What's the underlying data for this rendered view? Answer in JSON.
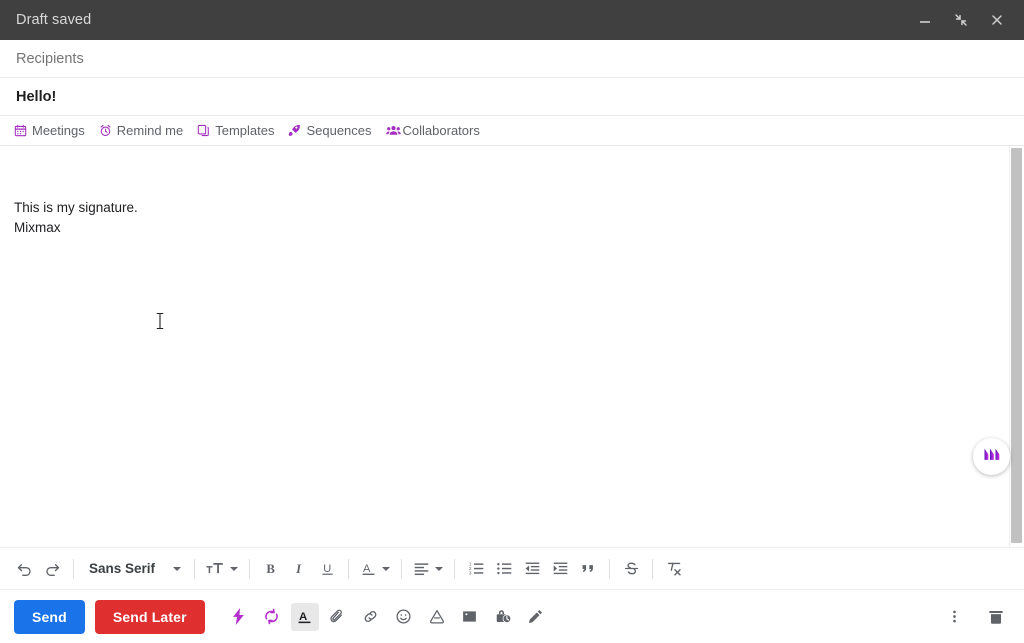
{
  "window": {
    "title": "Draft saved",
    "controls": [
      {
        "name": "minimize-button",
        "icon": "minimize-icon",
        "label": "Minimize"
      },
      {
        "name": "exit-fullscreen-button",
        "icon": "exit-fullscreen-icon",
        "label": "Exit full screen"
      },
      {
        "name": "close-button",
        "icon": "close-icon",
        "label": "Close"
      }
    ]
  },
  "fields": {
    "recipients_placeholder": "Recipients",
    "recipients_value": "",
    "subject_value": "Hello!"
  },
  "mixmax_bar": {
    "items": [
      {
        "label": "Meetings",
        "icon": "calendar-icon"
      },
      {
        "label": "Remind me",
        "icon": "alarm-clock-icon"
      },
      {
        "label": "Templates",
        "icon": "templates-icon"
      },
      {
        "label": "Sequences",
        "icon": "rocket-icon"
      },
      {
        "label": "Collaborators",
        "icon": "people-group-icon"
      }
    ],
    "accent_color": "#a42ec0"
  },
  "body": {
    "lines": [
      "This is my signature.",
      "Mixmax"
    ],
    "cursor": "text-ibeam-cursor"
  },
  "mixmax_bubble": {
    "label": "Mixmax",
    "logo": "mixmax-logo-icon",
    "color_start": "#6a1fb5",
    "color_end": "#d42ee0"
  },
  "format_toolbar": {
    "font_name": "Sans Serif",
    "items": [
      {
        "name": "undo-button",
        "icon": "undo-icon",
        "label": "Undo"
      },
      {
        "name": "redo-button",
        "icon": "redo-icon",
        "label": "Redo"
      },
      {
        "name": "font-family-picker",
        "icon": "chevron-down-icon",
        "label": "Sans Serif"
      },
      {
        "name": "font-size-button",
        "icon": "font-size-icon",
        "label": "Size"
      },
      {
        "name": "bold-button",
        "icon": "bold-icon",
        "label": "Bold"
      },
      {
        "name": "italic-button",
        "icon": "italic-icon",
        "label": "Italic"
      },
      {
        "name": "underline-button",
        "icon": "underline-icon",
        "label": "Underline"
      },
      {
        "name": "text-color-button",
        "icon": "text-color-icon",
        "label": "Text color"
      },
      {
        "name": "align-button",
        "icon": "align-left-icon",
        "label": "Align"
      },
      {
        "name": "numbered-list-button",
        "icon": "numbered-list-icon",
        "label": "Numbered list"
      },
      {
        "name": "bulleted-list-button",
        "icon": "bulleted-list-icon",
        "label": "Bulleted list"
      },
      {
        "name": "indent-less-button",
        "icon": "indent-less-icon",
        "label": "Indent less"
      },
      {
        "name": "indent-more-button",
        "icon": "indent-more-icon",
        "label": "Indent more"
      },
      {
        "name": "quote-button",
        "icon": "quote-icon",
        "label": "Quote"
      },
      {
        "name": "strikethrough-button",
        "icon": "strikethrough-icon",
        "label": "Strikethrough"
      },
      {
        "name": "remove-formatting-button",
        "icon": "remove-formatting-icon",
        "label": "Remove formatting"
      }
    ]
  },
  "action_bar": {
    "send_label": "Send",
    "send_later_label": "Send Later",
    "send_color": "#1a73e8",
    "send_later_color": "#e02f2f",
    "icons": [
      {
        "name": "mixmax-instant-button",
        "icon": "lightning-bolt-icon",
        "label": "Mixmax enhancements",
        "style": "purple"
      },
      {
        "name": "mixmax-sync-button",
        "icon": "sync-arrows-icon",
        "label": "Sync",
        "style": "purple"
      },
      {
        "name": "formatting-options-button",
        "icon": "text-format-icon",
        "label": "Formatting options",
        "style": "active"
      },
      {
        "name": "attach-file-button",
        "icon": "paperclip-icon",
        "label": "Attach files",
        "style": ""
      },
      {
        "name": "insert-link-button",
        "icon": "link-icon",
        "label": "Insert link",
        "style": ""
      },
      {
        "name": "insert-emoji-button",
        "icon": "emoji-icon",
        "label": "Insert emoji",
        "style": ""
      },
      {
        "name": "insert-drive-button",
        "icon": "google-drive-icon",
        "label": "Insert files using Drive",
        "style": ""
      },
      {
        "name": "insert-photo-button",
        "icon": "image-icon",
        "label": "Insert photo",
        "style": ""
      },
      {
        "name": "confidential-mode-button",
        "icon": "lock-clock-icon",
        "label": "Confidential mode",
        "style": ""
      },
      {
        "name": "insert-signature-button",
        "icon": "pen-icon",
        "label": "Insert signature",
        "style": ""
      }
    ],
    "right_icons": [
      {
        "name": "more-options-button",
        "icon": "more-vertical-icon",
        "label": "More options"
      },
      {
        "name": "discard-draft-button",
        "icon": "trash-icon",
        "label": "Discard draft"
      }
    ]
  }
}
